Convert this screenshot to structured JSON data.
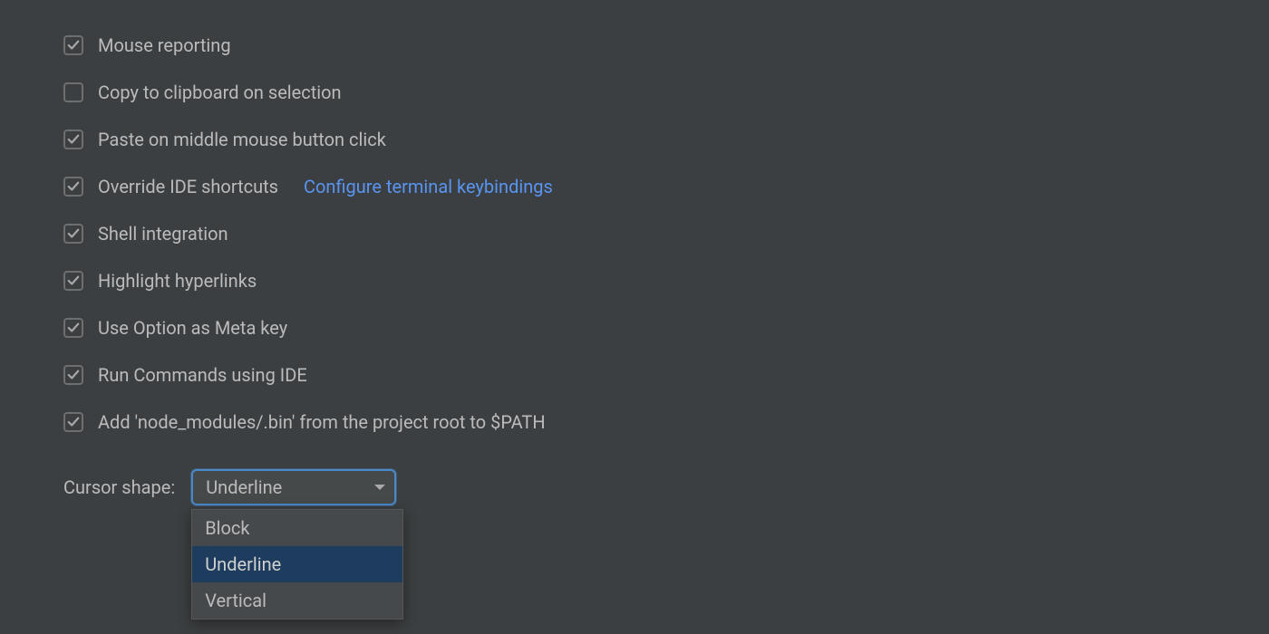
{
  "checkboxes": [
    {
      "id": "mouse-reporting",
      "label": "Mouse reporting",
      "checked": true
    },
    {
      "id": "copy-clipboard",
      "label": "Copy to clipboard on selection",
      "checked": false
    },
    {
      "id": "paste-middle",
      "label": "Paste on middle mouse button click",
      "checked": true
    },
    {
      "id": "override-shortcuts",
      "label": "Override IDE shortcuts",
      "checked": true,
      "link": "Configure terminal keybindings"
    },
    {
      "id": "shell-integration",
      "label": "Shell integration",
      "checked": true
    },
    {
      "id": "highlight-links",
      "label": "Highlight hyperlinks",
      "checked": true
    },
    {
      "id": "option-meta",
      "label": "Use Option as Meta key",
      "checked": true
    },
    {
      "id": "run-commands-ide",
      "label": "Run Commands using IDE",
      "checked": true
    },
    {
      "id": "add-node-bin",
      "label": "Add 'node_modules/.bin' from the project root to $PATH",
      "checked": true
    }
  ],
  "cursor_shape": {
    "label": "Cursor shape:",
    "value": "Underline",
    "options": [
      "Block",
      "Underline",
      "Vertical"
    ]
  }
}
